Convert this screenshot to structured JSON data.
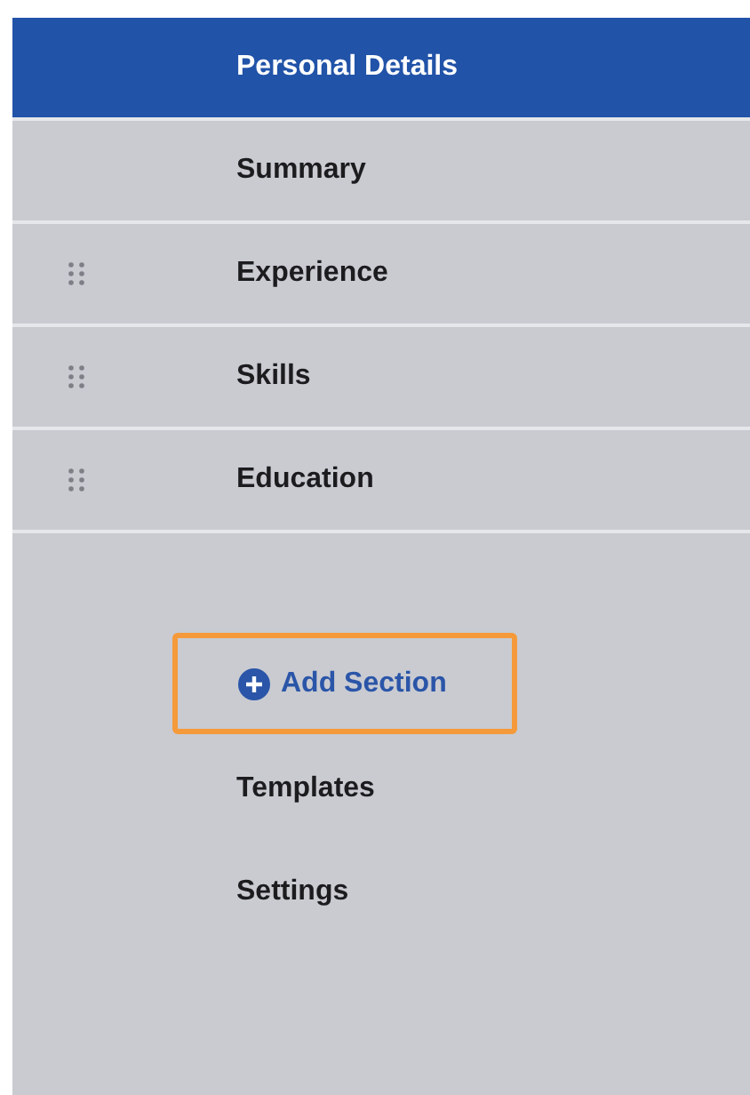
{
  "sections": [
    {
      "label": "Personal Details",
      "selected": true,
      "draggable": false
    },
    {
      "label": "Summary",
      "selected": false,
      "draggable": false
    },
    {
      "label": "Experience",
      "selected": false,
      "draggable": true
    },
    {
      "label": "Skills",
      "selected": false,
      "draggable": true
    },
    {
      "label": "Education",
      "selected": false,
      "draggable": true
    }
  ],
  "add_section": {
    "label": "Add Section",
    "highlighted": true
  },
  "links": [
    "Templates",
    "Settings"
  ]
}
